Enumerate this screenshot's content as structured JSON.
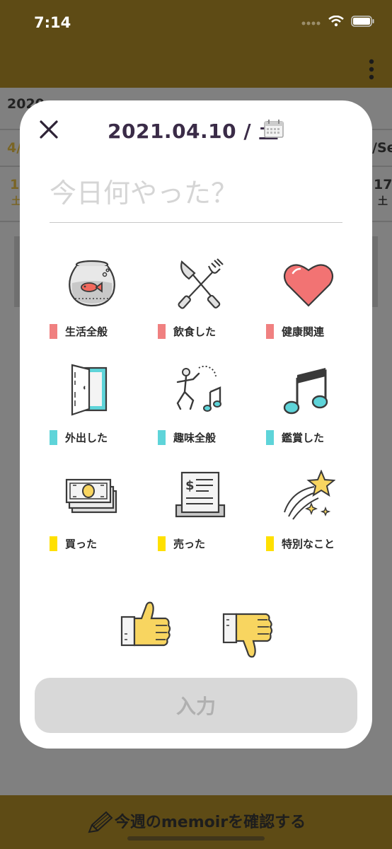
{
  "status_bar": {
    "time": "7:14"
  },
  "background": {
    "year_text": "2020",
    "col_left_top": "4/",
    "col_right_top": "/Se",
    "col_left_num": "1",
    "col_left_day": "土",
    "col_right_num": "17",
    "col_right_day": "土"
  },
  "modal": {
    "date": "2021.04.10 / 土",
    "input_placeholder": "今日何やった？",
    "input_value": "",
    "categories": [
      {
        "label": "生活全般",
        "icon": "goldfish-bowl-icon",
        "color": "#f08080"
      },
      {
        "label": "飲食した",
        "icon": "fork-knife-icon",
        "color": "#f08080"
      },
      {
        "label": "健康関連",
        "icon": "heart-icon",
        "color": "#f08080"
      },
      {
        "label": "外出した",
        "icon": "door-icon",
        "color": "#5ed4d9"
      },
      {
        "label": "趣味全般",
        "icon": "dancing-person-icon",
        "color": "#5ed4d9"
      },
      {
        "label": "鑑賞した",
        "icon": "music-note-icon",
        "color": "#5ed4d9"
      },
      {
        "label": "買った",
        "icon": "money-icon",
        "color": "#ffe000"
      },
      {
        "label": "売った",
        "icon": "receipt-icon",
        "color": "#ffe000"
      },
      {
        "label": "特別なこと",
        "icon": "shooting-star-icon",
        "color": "#ffe000"
      }
    ],
    "submit_label": "入力"
  },
  "bottom_bar": {
    "label": "今週のmemoirを確認する"
  },
  "colors": {
    "accent": "#806616",
    "dim_overlay": "#808080",
    "pink": "#f08080",
    "teal": "#5ed4d9",
    "yellow": "#ffe000"
  }
}
